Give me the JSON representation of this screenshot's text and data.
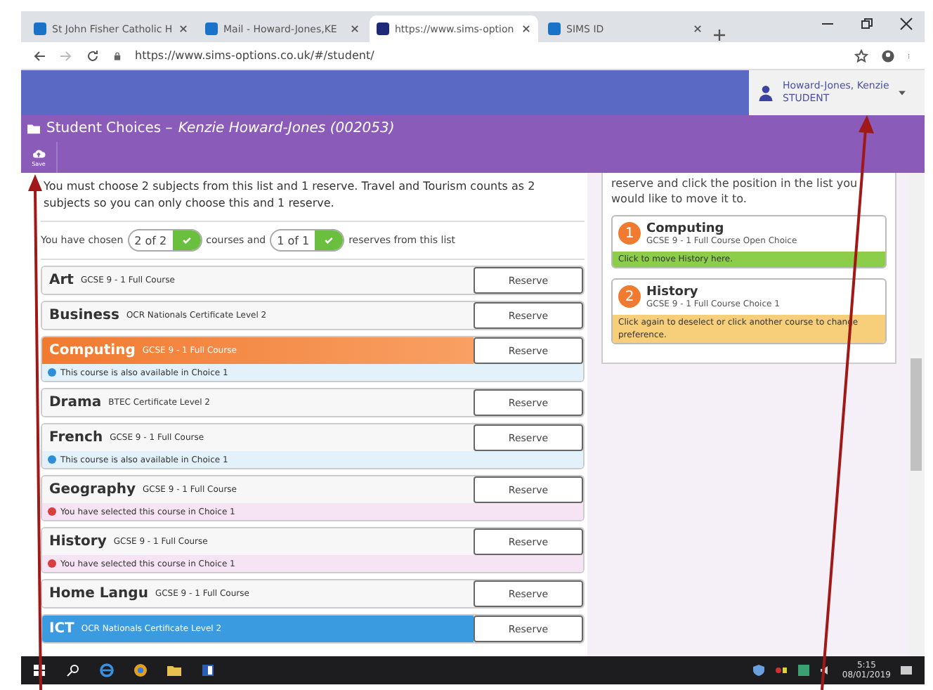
{
  "browser": {
    "tabs": [
      {
        "title": "St John Fisher Catholic H",
        "selected": false
      },
      {
        "title": "Mail - Howard-Jones,KE",
        "selected": false
      },
      {
        "title": "https://www.sims-option",
        "selected": true
      },
      {
        "title": "SIMS ID",
        "selected": false
      }
    ],
    "address": "https://www.sims-options.co.uk/#/student/"
  },
  "user": {
    "name": "Howard-Jones, Kenzie",
    "role": "STUDENT"
  },
  "page": {
    "title": "Student Choices – ",
    "student": "Kenzie Howard-Jones (002053)",
    "save_label": "Save"
  },
  "instructions": "You must choose 2 subjects from this list and 1 reserve. Travel and Tourism counts as 2 subjects so you can only choose this and 1 reserve.",
  "counters": {
    "prefix": "You have chosen",
    "courses": {
      "value": "2 of 2",
      "complete": true
    },
    "middle": "courses and",
    "reserves": {
      "value": "1 of 1",
      "complete": true
    },
    "suffix": "reserves from this list"
  },
  "courses": [
    {
      "name": "Art",
      "qualification": "GCSE 9 - 1 Full Course",
      "chosen": false,
      "reserved": false,
      "button": "Reserve"
    },
    {
      "name": "Business",
      "qualification": "OCR Nationals Certificate Level 2",
      "chosen": false,
      "reserved": false,
      "button": "Reserve"
    },
    {
      "name": "Computing",
      "qualification": "GCSE 9 - 1 Full Course",
      "chosen": true,
      "reserved": false,
      "button": "Reserve",
      "note": {
        "kind": "info",
        "text": "This course is also available in Choice 1"
      }
    },
    {
      "name": "Drama",
      "qualification": "BTEC Certificate Level 2",
      "chosen": false,
      "reserved": false,
      "button": "Reserve"
    },
    {
      "name": "French",
      "qualification": "GCSE 9 - 1 Full Course",
      "chosen": false,
      "reserved": false,
      "button": "Reserve",
      "note": {
        "kind": "info",
        "text": "This course is also available in Choice 1"
      }
    },
    {
      "name": "Geography",
      "qualification": "GCSE 9 - 1 Full Course",
      "chosen": false,
      "reserved": false,
      "button": "Reserve",
      "note": {
        "kind": "warning",
        "text": "You have selected this course in Choice 1"
      }
    },
    {
      "name": "History",
      "qualification": "GCSE 9 - 1 Full Course",
      "chosen": false,
      "reserved": false,
      "button": "Reserve",
      "note": {
        "kind": "warning",
        "text": "You have selected this course in Choice 1"
      }
    },
    {
      "name": "Home Langu",
      "qualification": "GCSE 9 - 1 Full Course",
      "chosen": false,
      "reserved": false,
      "button": "Reserve"
    },
    {
      "name": "ICT",
      "qualification": "OCR Nationals Certificate Level 2",
      "chosen": false,
      "reserved": true,
      "button": "Reserve"
    }
  ],
  "preference_help": "reserve and click the position in the list you would like to move it to.",
  "preferences": [
    {
      "number": "1",
      "name": "Computing",
      "detail": "GCSE 9 - 1 Full Course Open Choice",
      "message": {
        "kind": "target",
        "text": "Click to move History here."
      }
    },
    {
      "number": "2",
      "name": "History",
      "detail": "GCSE 9 - 1 Full Course Choice 1",
      "message": {
        "kind": "pending",
        "text": "Click again to deselect or click another course to change preference."
      }
    }
  ],
  "taskbar": {
    "time": "5:15",
    "date": "08/01/2019"
  }
}
